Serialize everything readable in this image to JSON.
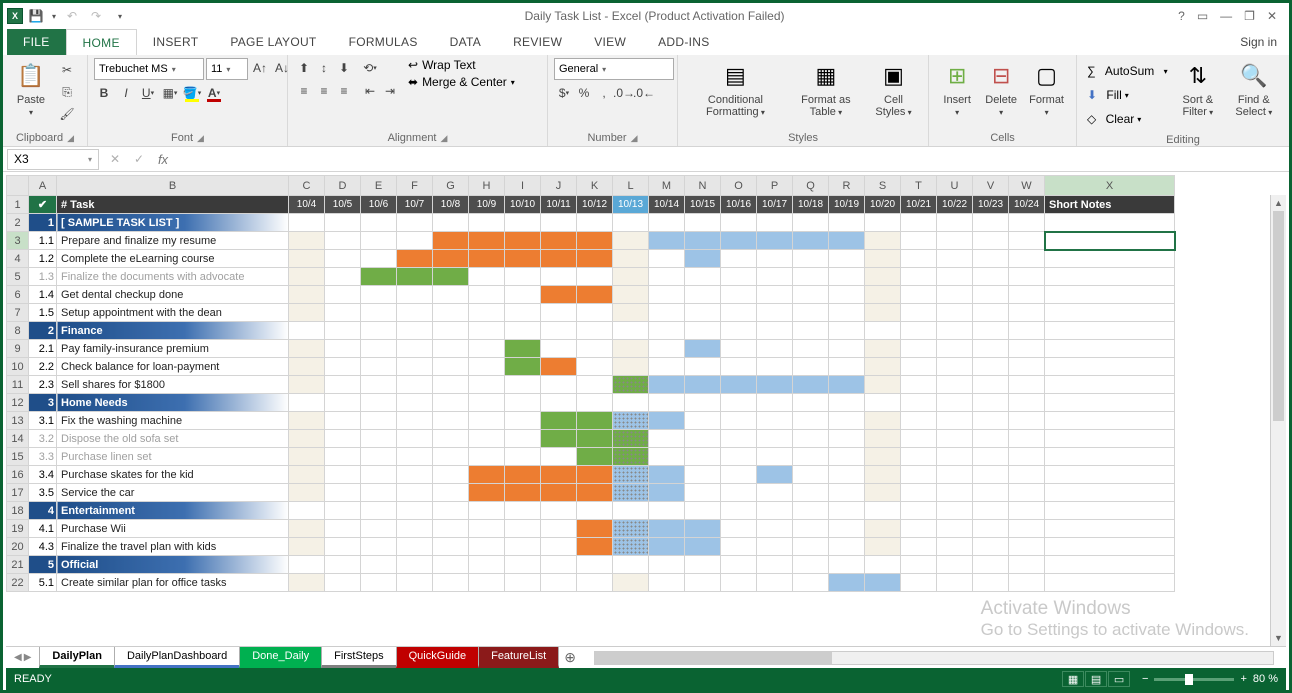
{
  "title": "Daily Task List - Excel (Product Activation Failed)",
  "signin": "Sign in",
  "tabs": [
    "FILE",
    "HOME",
    "INSERT",
    "PAGE LAYOUT",
    "FORMULAS",
    "DATA",
    "REVIEW",
    "VIEW",
    "ADD-INS"
  ],
  "ribbon": {
    "clipboard": {
      "label": "Clipboard",
      "paste": "Paste"
    },
    "font": {
      "label": "Font",
      "name": "Trebuchet MS",
      "size": "11"
    },
    "alignment": {
      "label": "Alignment",
      "wrap": "Wrap Text",
      "merge": "Merge & Center"
    },
    "number": {
      "label": "Number",
      "format": "General"
    },
    "styles": {
      "label": "Styles",
      "cond": "Conditional Formatting",
      "fmtas": "Format as Table",
      "cell": "Cell Styles"
    },
    "cells": {
      "label": "Cells",
      "insert": "Insert",
      "delete": "Delete",
      "format": "Format"
    },
    "editing": {
      "label": "Editing",
      "autosum": "AutoSum",
      "fill": "Fill",
      "clear": "Clear",
      "sort": "Sort & Filter",
      "find": "Find & Select"
    }
  },
  "namebox": "X3",
  "columns": [
    "A",
    "B",
    "C",
    "D",
    "E",
    "F",
    "G",
    "H",
    "I",
    "J",
    "K",
    "L",
    "M",
    "N",
    "O",
    "P",
    "Q",
    "R",
    "S",
    "T",
    "U",
    "V",
    "W",
    "X"
  ],
  "header": {
    "num": "#",
    "task": "Task",
    "shortnotes": "Short Notes"
  },
  "dates": [
    "10/4",
    "10/5",
    "10/6",
    "10/7",
    "10/8",
    "10/9",
    "10/10",
    "10/11",
    "10/12",
    "10/13",
    "10/14",
    "10/15",
    "10/16",
    "10/17",
    "10/18",
    "10/19",
    "10/20",
    "10/21",
    "10/22",
    "10/23",
    "10/24"
  ],
  "todayIndex": 9,
  "beigeCols": [
    0,
    9,
    16
  ],
  "rows": [
    {
      "r": 2,
      "type": "section",
      "num": "1",
      "task": "[ SAMPLE TASK LIST ]"
    },
    {
      "r": 3,
      "type": "task",
      "num": "1.1",
      "task": "Prepare and finalize my resume",
      "bars": [
        [
          4,
          8,
          "o"
        ],
        [
          10,
          15,
          "b"
        ]
      ]
    },
    {
      "r": 4,
      "type": "task",
      "num": "1.2",
      "task": "Complete the eLearning course",
      "bars": [
        [
          3,
          8,
          "o"
        ],
        [
          11,
          11,
          "b"
        ]
      ]
    },
    {
      "r": 5,
      "type": "task",
      "num": "1.3",
      "task": "Finalize the documents with advocate",
      "dim": true,
      "bars": [
        [
          2,
          4,
          "g"
        ]
      ]
    },
    {
      "r": 6,
      "type": "task",
      "num": "1.4",
      "task": "Get dental checkup done",
      "bars": [
        [
          7,
          8,
          "o"
        ]
      ]
    },
    {
      "r": 7,
      "type": "task",
      "num": "1.5",
      "task": "Setup appointment with the dean",
      "bars": []
    },
    {
      "r": 8,
      "type": "section",
      "num": "2",
      "task": "Finance"
    },
    {
      "r": 9,
      "type": "task",
      "num": "2.1",
      "task": "Pay family-insurance premium",
      "bars": [
        [
          6,
          6,
          "g"
        ],
        [
          11,
          11,
          "b"
        ]
      ]
    },
    {
      "r": 10,
      "type": "task",
      "num": "2.2",
      "task": "Check balance for loan-payment",
      "bars": [
        [
          6,
          6,
          "g"
        ],
        [
          7,
          7,
          "o"
        ]
      ]
    },
    {
      "r": 11,
      "type": "task",
      "num": "2.3",
      "task": "Sell shares for $1800",
      "bars": [
        [
          9,
          9,
          "g"
        ],
        [
          10,
          15,
          "b"
        ]
      ]
    },
    {
      "r": 12,
      "type": "section",
      "num": "3",
      "task": "Home Needs"
    },
    {
      "r": 13,
      "type": "task",
      "num": "3.1",
      "task": "Fix the washing machine",
      "bars": [
        [
          7,
          8,
          "g"
        ],
        [
          9,
          9,
          "b"
        ],
        [
          10,
          10,
          "b"
        ]
      ]
    },
    {
      "r": 14,
      "type": "task",
      "num": "3.2",
      "task": "Dispose the old sofa set",
      "dim": true,
      "bars": [
        [
          7,
          9,
          "g"
        ]
      ]
    },
    {
      "r": 15,
      "type": "task",
      "num": "3.3",
      "task": "Purchase linen set",
      "dim": true,
      "bars": [
        [
          8,
          9,
          "g"
        ]
      ]
    },
    {
      "r": 16,
      "type": "task",
      "num": "3.4",
      "task": "Purchase skates for the kid",
      "bars": [
        [
          5,
          8,
          "o"
        ],
        [
          9,
          10,
          "b"
        ],
        [
          13,
          13,
          "b"
        ]
      ]
    },
    {
      "r": 17,
      "type": "task",
      "num": "3.5",
      "task": "Service the car",
      "bars": [
        [
          5,
          8,
          "o"
        ],
        [
          9,
          10,
          "b"
        ]
      ]
    },
    {
      "r": 18,
      "type": "section",
      "num": "4",
      "task": "Entertainment"
    },
    {
      "r": 19,
      "type": "task",
      "num": "4.1",
      "task": "Purchase Wii",
      "bars": [
        [
          8,
          8,
          "o"
        ],
        [
          9,
          11,
          "b"
        ]
      ]
    },
    {
      "r": 20,
      "type": "task",
      "num": "4.3",
      "task": "Finalize the travel plan with kids",
      "bars": [
        [
          8,
          8,
          "o"
        ],
        [
          9,
          11,
          "b"
        ]
      ]
    },
    {
      "r": 21,
      "type": "section",
      "num": "5",
      "task": "Official"
    },
    {
      "r": 22,
      "type": "task",
      "num": "5.1",
      "task": "Create similar plan for office tasks",
      "bars": [
        [
          15,
          16,
          "b"
        ]
      ]
    }
  ],
  "sheets": [
    {
      "name": "DailyPlan",
      "cls": "active"
    },
    {
      "name": "DailyPlanDashboard",
      "cls": "t-blue"
    },
    {
      "name": "Done_Daily",
      "cls": "t-green"
    },
    {
      "name": "FirstSteps",
      "cls": "t-gray"
    },
    {
      "name": "QuickGuide",
      "cls": "t-red"
    },
    {
      "name": "FeatureList",
      "cls": "t-dred"
    }
  ],
  "status": "READY",
  "zoom": "80 %",
  "watermark": {
    "l1": "Activate Windows",
    "l2": "Go to Settings to activate Windows."
  }
}
